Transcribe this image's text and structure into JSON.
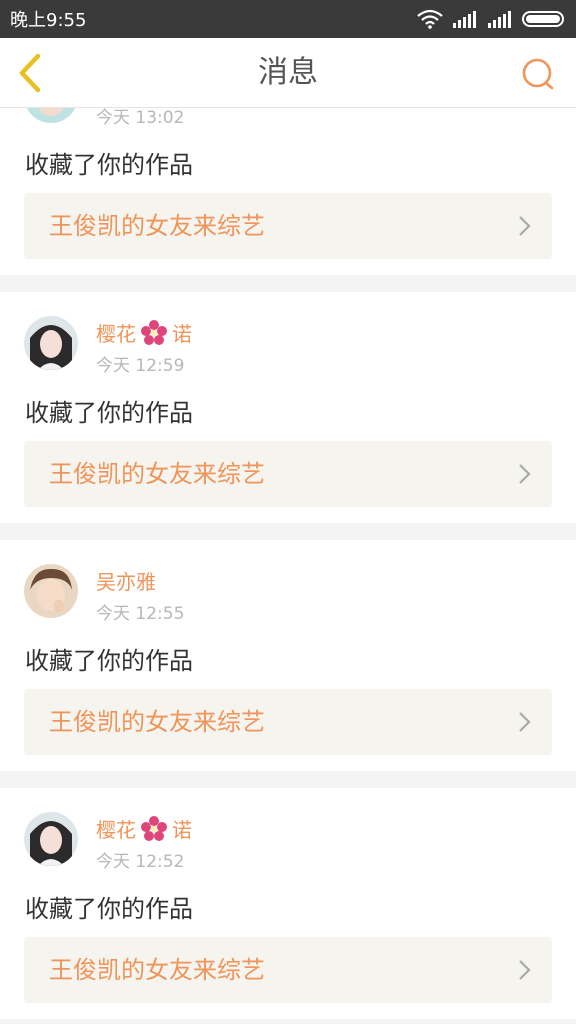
{
  "status_bar": {
    "time": "晚上9:55"
  },
  "header": {
    "title": "消息"
  },
  "colors": {
    "accent": "#f0955a",
    "back": "#e8c020",
    "text": "#333333",
    "muted": "#b7b7b7",
    "work_bg": "#f5f4ef"
  },
  "notifications": [
    {
      "username": "",
      "time": "今天 13:02",
      "action": "收藏了你的作品",
      "work_title": "王俊凯的女友来综艺"
    },
    {
      "username_left": "樱花",
      "username_right": "诺",
      "has_flower": true,
      "time": "今天 12:59",
      "action": "收藏了你的作品",
      "work_title": "王俊凯的女友来综艺"
    },
    {
      "username": "吴亦雅",
      "time": "今天 12:55",
      "action": "收藏了你的作品",
      "work_title": "王俊凯的女友来综艺"
    },
    {
      "username_left": "樱花",
      "username_right": "诺",
      "has_flower": true,
      "time": "今天 12:52",
      "action": "收藏了你的作品",
      "work_title": "王俊凯的女友来综艺"
    }
  ]
}
